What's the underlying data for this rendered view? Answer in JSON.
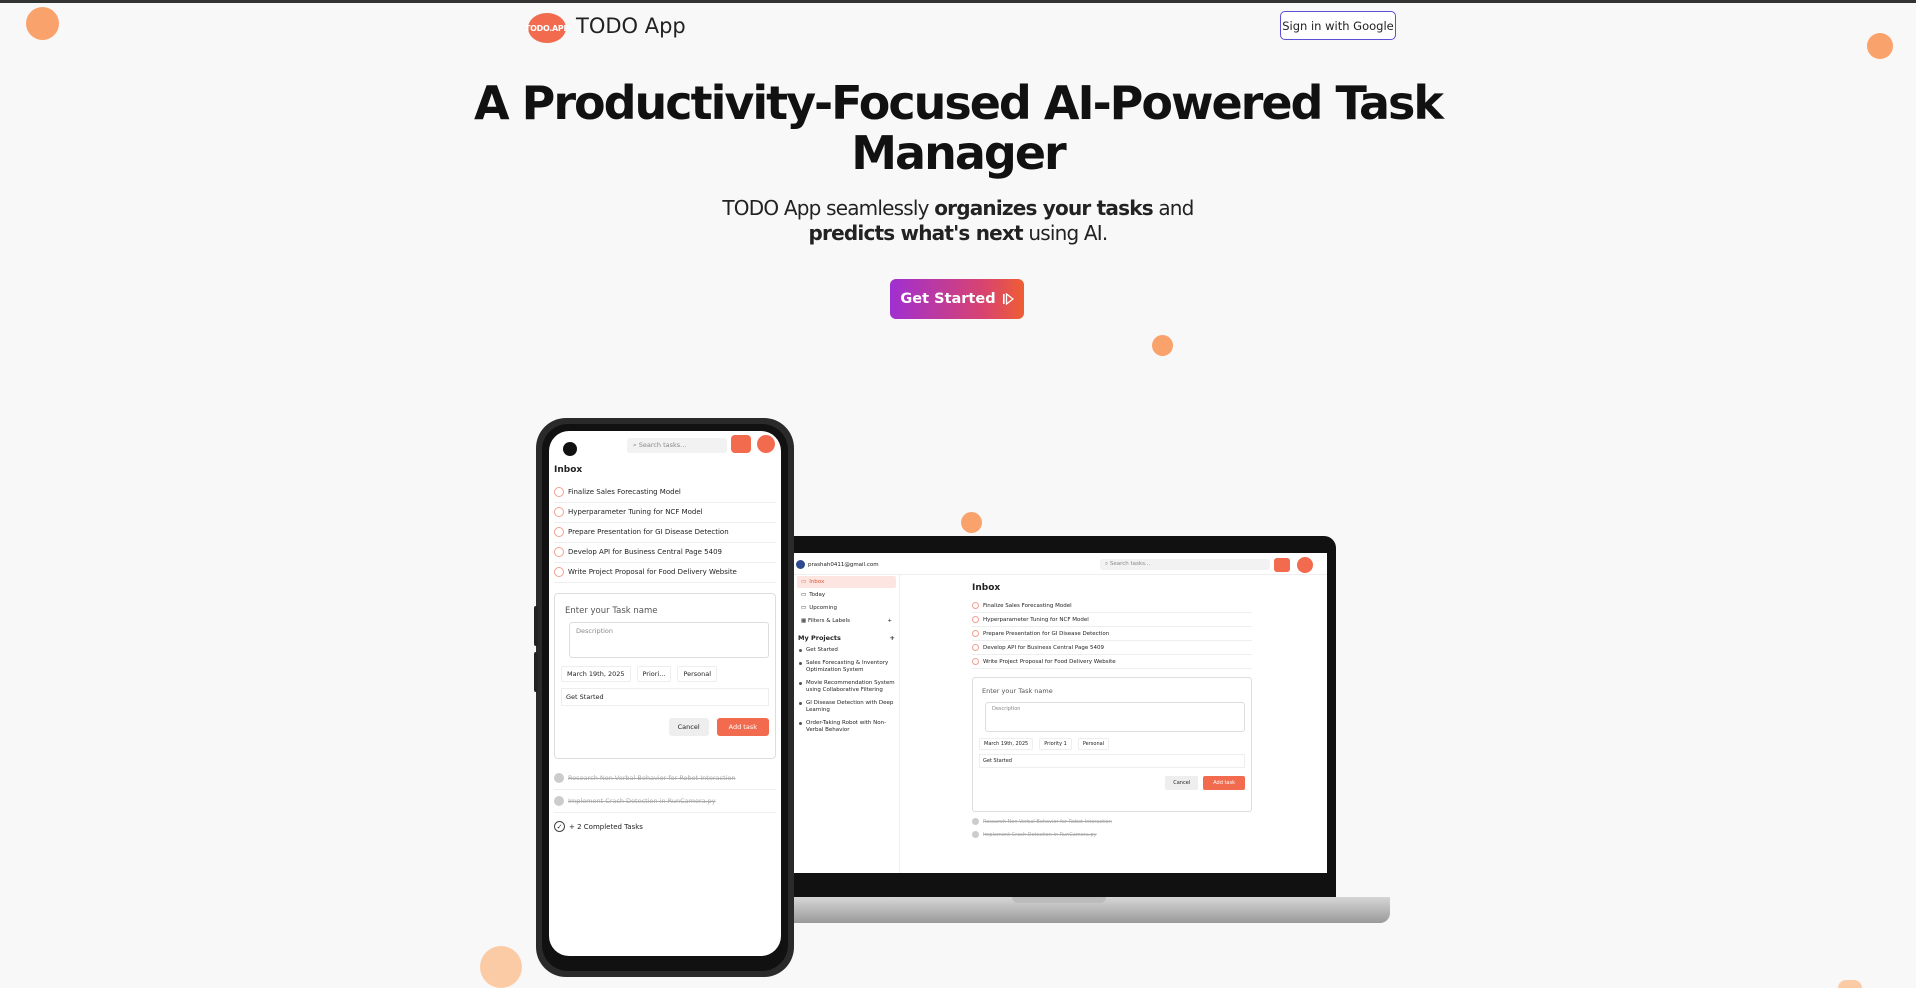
{
  "nav": {
    "logo_text": "TODO.APP",
    "brand": "TODO App",
    "signin_label": "Sign in with Google"
  },
  "hero": {
    "title_line1": "A Productivity-Focused AI-Powered Task",
    "title_line2": "Manager",
    "sub_a": "TODO App seamlessly ",
    "sub_b": "organizes your tasks",
    "sub_c": "  and",
    "sub_d": "predicts what's next",
    "sub_e": " using AI.",
    "cta_label": "Get Started",
    "cta_icon": "play-step-icon"
  },
  "mockup": {
    "user_email": "prashah0411@gmail.com",
    "search_placeholder": "Search tasks...",
    "inbox_title": "Inbox",
    "nav_items": [
      "Inbox",
      "Today",
      "Upcoming",
      "Filters & Labels"
    ],
    "projects_header": "My Projects",
    "projects": [
      "Get Started",
      "Sales Forecasting & Inventory Optimization System",
      "Movie Recommendation System using Collaborative Filtering",
      "GI Disease Detection with Deep Learning",
      "Order-Taking Robot with Non-Verbal Behavior"
    ],
    "tasks": [
      "Finalize Sales Forecasting Model",
      "Hyperparameter Tuning for NCF Model",
      "Prepare Presentation for GI Disease Detection",
      "Develop API for Business Central Page 5409",
      "Write Project Proposal for Food Delivery Website"
    ],
    "form": {
      "task_name_placeholder": "Enter your Task name",
      "description_placeholder": "Description",
      "date": "March 19th, 2025",
      "priority_phone": "Priori...",
      "priority_laptop": "Priority 1",
      "label": "Personal",
      "project": "Get Started",
      "cancel": "Cancel",
      "add": "Add task"
    },
    "completed": [
      "Research Non-Verbal Behavior for Robot Interaction",
      "Implement Crash Detection in RunCamera.py"
    ],
    "completed_more": "+ 2 Completed Tasks"
  },
  "colors": {
    "accent": "#f26b4e",
    "cta_gradient_start": "#a02fd1",
    "cta_gradient_end": "#ef5d34",
    "signin_border": "#5b4fd6",
    "decor_dot": "#f9a26c"
  }
}
